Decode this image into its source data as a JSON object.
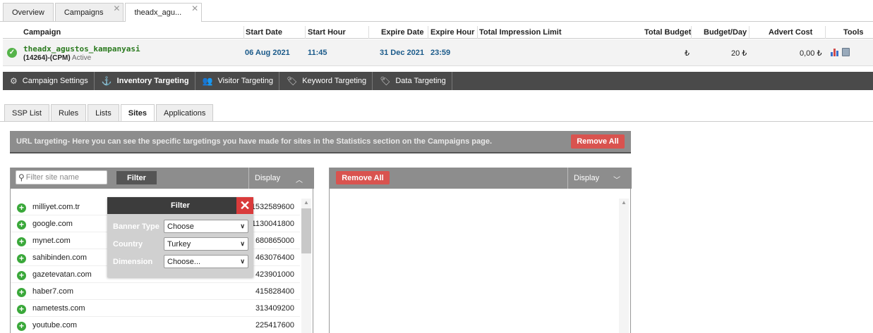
{
  "top_tabs": [
    {
      "label": "Overview",
      "closable": false,
      "active": false
    },
    {
      "label": "Campaigns",
      "closable": true,
      "active": false
    },
    {
      "label": "theadx_agu...",
      "closable": true,
      "active": true
    }
  ],
  "campaign_table": {
    "headers": {
      "campaign": "Campaign",
      "start_date": "Start Date",
      "start_hour": "Start Hour",
      "expire_date": "Expire Date",
      "expire_hour": "Expire Hour",
      "impression_limit": "Total Impression Limit",
      "total_budget": "Total Budget",
      "budget_day": "Budget/Day",
      "advert_cost": "Advert Cost",
      "tools": "Tools"
    },
    "row": {
      "name": "theadx_agustos_kampanyasi",
      "id_type": "(14264)-(CPM)",
      "status": "Active",
      "start_date": "06 Aug 2021",
      "start_hour": "11:45",
      "expire_date": "31 Dec 2021",
      "expire_hour": "23:59",
      "total_budget": "₺",
      "budget_day": "20 ₺",
      "advert_cost": "0,00 ₺"
    }
  },
  "nav": [
    {
      "label": "Campaign Settings",
      "icon": "gear-icon",
      "glyph": "⚙"
    },
    {
      "label": "Inventory Targeting",
      "icon": "anchor-icon",
      "glyph": "⚓",
      "active": true
    },
    {
      "label": "Visitor Targeting",
      "icon": "users-icon",
      "glyph": "👥"
    },
    {
      "label": "Keyword Targeting",
      "icon": "tag-icon",
      "glyph": "🏷"
    },
    {
      "label": "Data Targeting",
      "icon": "data-tag-icon",
      "glyph": "🏷"
    }
  ],
  "sub_tabs": [
    {
      "label": "SSP List"
    },
    {
      "label": "Rules"
    },
    {
      "label": "Lists"
    },
    {
      "label": "Sites",
      "active": true
    },
    {
      "label": "Applications"
    }
  ],
  "info_bar": {
    "text": "URL targeting- Here you can see the specific targetings you have made for sites in the Statistics section on the Campaigns page.",
    "remove_all": "Remove All"
  },
  "left_panel": {
    "search_placeholder": "Filter site name",
    "filter_button": "Filter",
    "display_label": "Display",
    "sites": [
      {
        "name": "milliyet.com.tr",
        "value": "1532589600"
      },
      {
        "name": "google.com",
        "value": "1130041800"
      },
      {
        "name": "mynet.com",
        "value": "680865000"
      },
      {
        "name": "sahibinden.com",
        "value": "463076400"
      },
      {
        "name": "gazetevatan.com",
        "value": "423901000"
      },
      {
        "name": "haber7.com",
        "value": "415828400"
      },
      {
        "name": "nametests.com",
        "value": "313409200"
      },
      {
        "name": "youtube.com",
        "value": "225417600"
      }
    ]
  },
  "filter_popup": {
    "title": "Filter",
    "banner_type_label": "Banner Type",
    "banner_type_value": "Choose",
    "country_label": "Country",
    "country_value": "Turkey",
    "dimension_label": "Dimension",
    "dimension_value": "Choose..."
  },
  "right_panel": {
    "remove_all": "Remove All",
    "display_label": "Display"
  },
  "colors": {
    "accent_red": "#d9534f",
    "nav_dark": "#4a4a4a",
    "panel_gray": "#8d8d8d",
    "active_green": "#55b34a",
    "link_blue": "#1a5a8a"
  }
}
